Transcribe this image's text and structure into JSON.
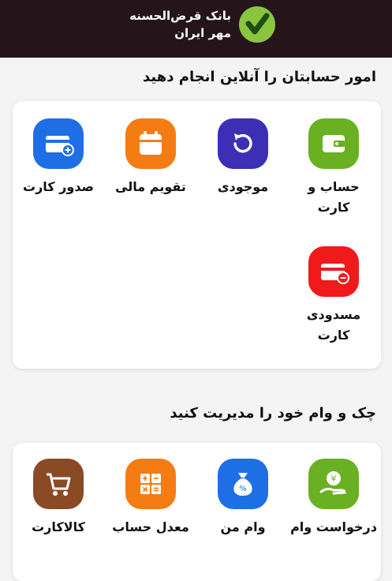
{
  "header": {
    "bank_name_line1": "بانک قرض‌الحسنه",
    "bank_name_line2": "مهر ایران",
    "logo": "check-logo"
  },
  "sections": [
    {
      "title": "امور حسابتان را آنلاین انجام دهید",
      "items": [
        {
          "label": "حساب و کارت",
          "icon": "wallet-icon",
          "color": "#6ab023"
        },
        {
          "label": "موجودی",
          "icon": "refresh-icon",
          "color": "#3c2fb5"
        },
        {
          "label": "تقویم مالی",
          "icon": "calendar-icon",
          "color": "#f57c12"
        },
        {
          "label": "صدور کارت",
          "icon": "card-add-icon",
          "color": "#1e6fe6"
        },
        {
          "label": "مسدودی کارت",
          "icon": "card-block-icon",
          "color": "#f01a1a"
        }
      ]
    },
    {
      "title": "چک و وام خود را مدیریت کنید",
      "items": [
        {
          "label": "درخواست وام",
          "icon": "loan-request-icon",
          "color": "#6ab023"
        },
        {
          "label": "وام من",
          "icon": "money-bag-icon",
          "color": "#1e6fe6"
        },
        {
          "label": "معدل حساب",
          "icon": "calculator-icon",
          "color": "#f57c12"
        },
        {
          "label": "کالاکارت",
          "icon": "cart-icon",
          "color": "#8a4a24"
        }
      ]
    }
  ]
}
